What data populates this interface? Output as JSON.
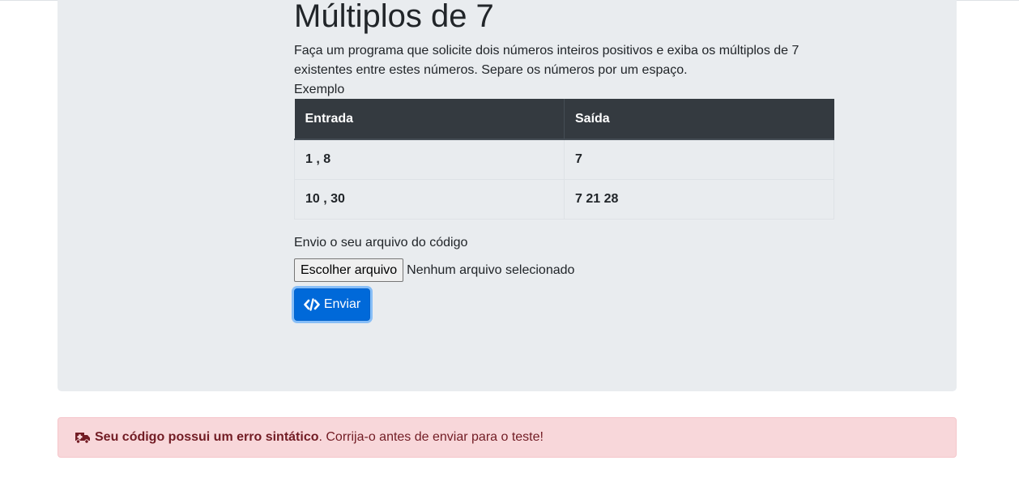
{
  "problem": {
    "title": "Múltiplos de 7",
    "description": "Faça um programa que solicite dois números inteiros positivos e exiba os múltiplos de 7 existentes entre estes números. Separe os números por um espaço.",
    "example_label": "Exemplo",
    "table": {
      "headers": [
        "Entrada",
        "Saída"
      ],
      "rows": [
        [
          "1 , 8",
          "7"
        ],
        [
          "10 , 30",
          "7 21 28"
        ]
      ]
    }
  },
  "upload": {
    "label": "Envio o seu arquivo do código",
    "choose_button": "Escolher arquivo",
    "status": "Nenhum arquivo selecionado"
  },
  "submit": {
    "label": "Enviar",
    "icon": "code-icon"
  },
  "alert": {
    "icon": "ambulance-icon",
    "bold_text": "Seu código possui um erro sintático",
    "text": ". Corrija-o antes de enviar para o teste!"
  },
  "colors": {
    "jumbotron_bg": "#e9ecef",
    "table_header_bg": "#343a40",
    "primary": "#0069d9",
    "alert_bg": "#f8d7da",
    "alert_text": "#721c24"
  }
}
